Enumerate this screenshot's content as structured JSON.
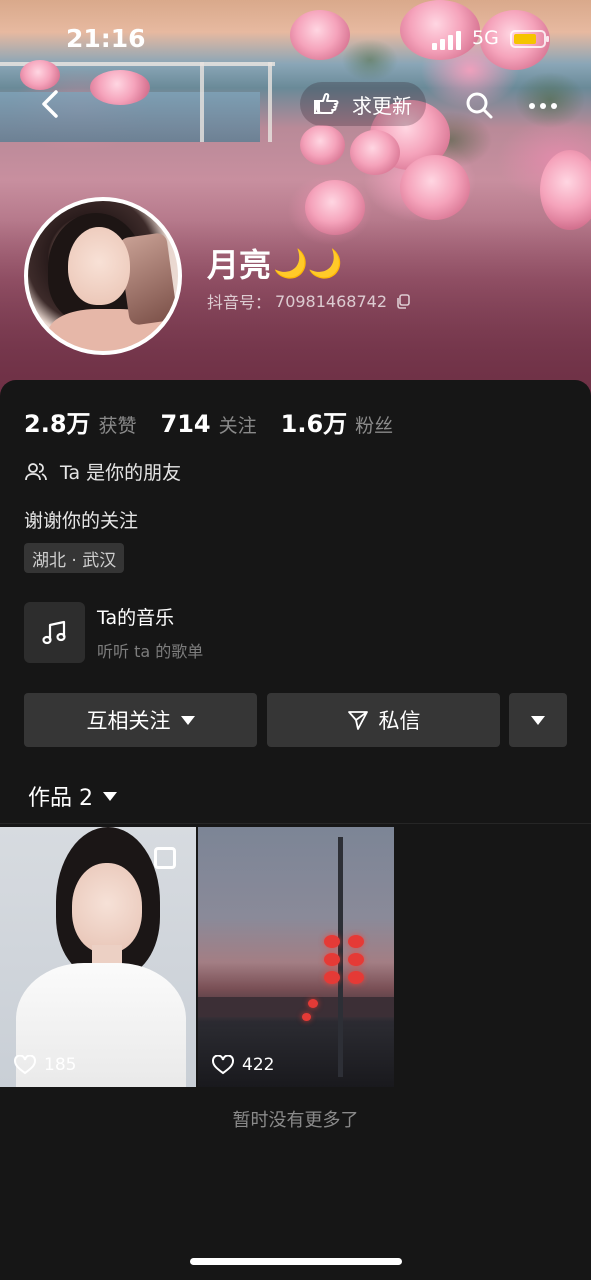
{
  "status_bar": {
    "time": "21:16",
    "network": "5G",
    "battery_color": "#f5c400"
  },
  "top_nav": {
    "update_label": "求更新"
  },
  "profile": {
    "nickname": "月亮",
    "nickname_emoji": "🌙🌙",
    "douyin_id_label": "抖音号：",
    "douyin_id": "70981468742"
  },
  "stats": [
    {
      "value": "2.8万",
      "label": "获赞"
    },
    {
      "value": "714",
      "label": "关注"
    },
    {
      "value": "1.6万",
      "label": "粉丝"
    }
  ],
  "friend_text": "Ta 是你的朋友",
  "bio": "谢谢你的关注",
  "location": "湖北 · 武汉",
  "music": {
    "title": "Ta的音乐",
    "subtitle": "听听 ta 的歌单"
  },
  "actions": {
    "follow_label": "互相关注",
    "message_label": "私信"
  },
  "works": {
    "tab_label": "作品 2",
    "items": [
      {
        "likes": "185"
      },
      {
        "likes": "422"
      }
    ],
    "end_text": "暂时没有更多了"
  }
}
